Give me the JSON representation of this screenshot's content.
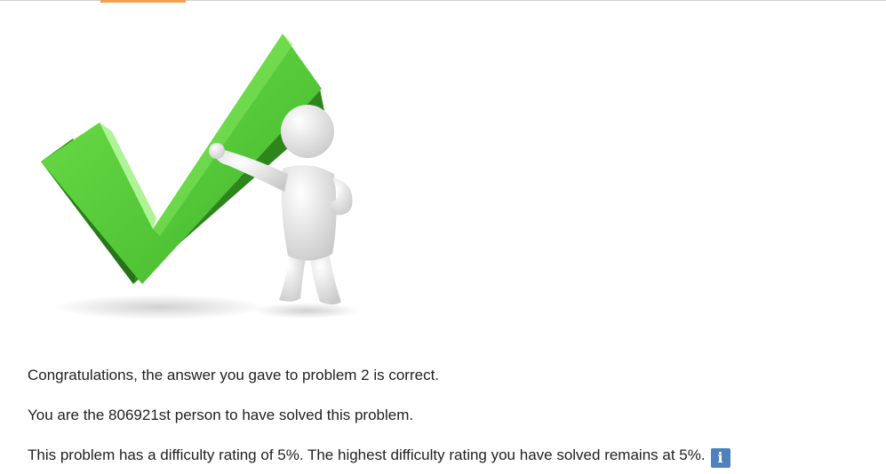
{
  "theme": {
    "accent_color": "#f0a050",
    "check_green": "#4cc130",
    "info_badge_color": "#4f81bd"
  },
  "illustration": {
    "icon": "checkmark-with-figure-icon"
  },
  "result": {
    "congratulations": "Congratulations, the answer you gave to problem 2 is correct.",
    "solver_count": "You are the 806921st person to have solved this problem.",
    "difficulty": "This problem has a difficulty rating of 5%. The highest difficulty rating you have solved remains at 5%.",
    "info_icon": "i"
  }
}
